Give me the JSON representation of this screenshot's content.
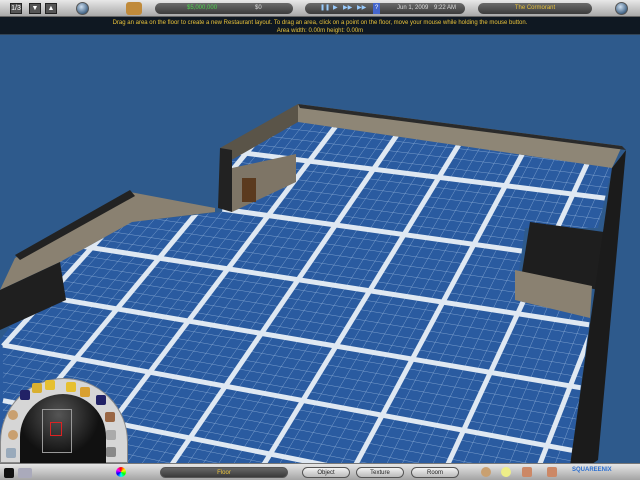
{
  "top_bar": {
    "page_indicator": "1/3",
    "money": "$5,000,000",
    "balance": "$0",
    "date": "Jun 1, 2009",
    "time": "9:22 AM",
    "restaurant_name": "The Cormorant"
  },
  "message": {
    "line1": "Drag an area on the floor to create a new Restaurant layout.  To drag an area, click on a point on the floor, move your mouse while holding the mouse button.",
    "line2": "Area width: 0.00m height: 0.00m"
  },
  "bottom_bar": {
    "active_mode": "Floor",
    "tabs": [
      "Object",
      "Texture",
      "Room"
    ],
    "logo": "SQUAREENIX"
  },
  "colors": {
    "floor": "#2a5ba0",
    "grid": "#dfe8f2",
    "money": "#4cd64c",
    "accent": "#e8c23a"
  }
}
